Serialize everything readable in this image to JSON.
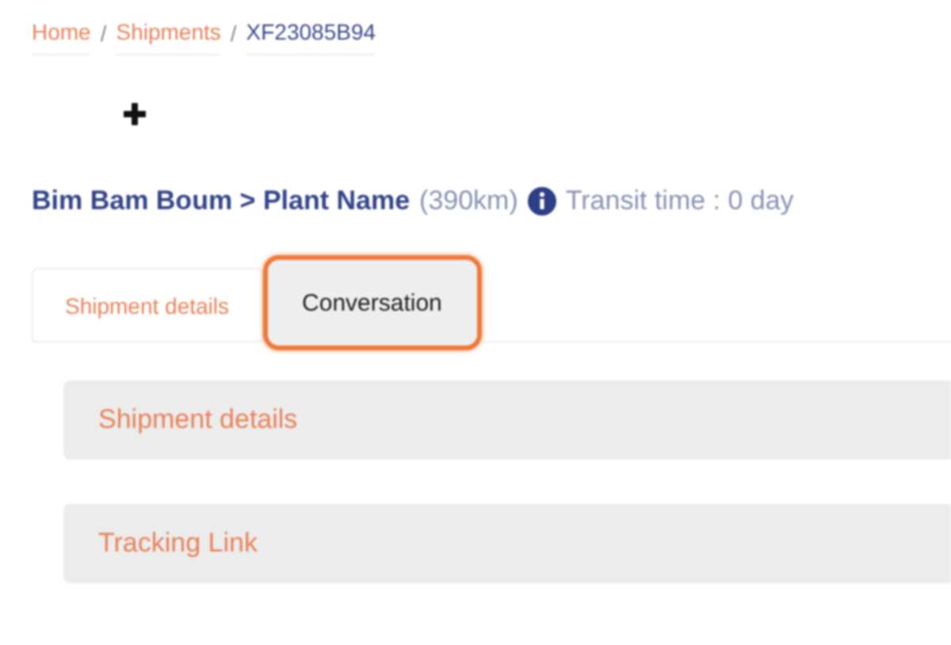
{
  "breadcrumb": [
    {
      "label": "Home",
      "kind": "link"
    },
    {
      "label": "/",
      "kind": "separator"
    },
    {
      "label": "Shipments",
      "kind": "link"
    },
    {
      "label": "/",
      "kind": "separator"
    },
    {
      "label": "XF23085B94",
      "kind": "current"
    }
  ],
  "route": {
    "title": "Bim Bam Boum > Plant Name",
    "distance": "(390km)",
    "transit": "Transit time : 0 day"
  },
  "tabs": [
    {
      "label": "Shipment details",
      "selected": true,
      "highlighted": false
    },
    {
      "label": "Conversation",
      "selected": false,
      "highlighted": true
    }
  ],
  "sections": [
    {
      "title": "Shipment details"
    },
    {
      "title": "Tracking Link"
    }
  ]
}
